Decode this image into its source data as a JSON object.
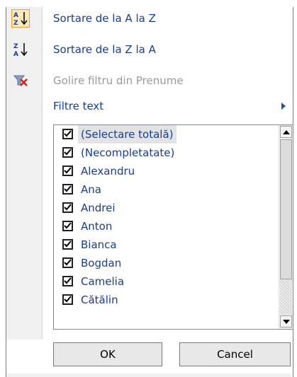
{
  "menu": {
    "items": [
      {
        "label": "Sortare de la A la Z",
        "icon": "sort-asc-icon",
        "state": "normal"
      },
      {
        "label": "Sortare de la Z la A",
        "icon": "sort-desc-icon",
        "state": "normal"
      },
      {
        "label": "Golire filtru din Prenume",
        "icon": "clear-filter-icon",
        "state": "disabled"
      },
      {
        "label": "Filtre text",
        "icon": "",
        "state": "submenu"
      }
    ]
  },
  "list": {
    "items": [
      {
        "label": "(Selectare totală)",
        "checked": true,
        "selected": true
      },
      {
        "label": "(Necompletatate)",
        "checked": true
      },
      {
        "label": "Alexandru",
        "checked": true
      },
      {
        "label": "Ana",
        "checked": true
      },
      {
        "label": "Andrei",
        "checked": true
      },
      {
        "label": "Anton",
        "checked": true
      },
      {
        "label": "Bianca",
        "checked": true
      },
      {
        "label": "Bogdan",
        "checked": true
      },
      {
        "label": "Camelia",
        "checked": true
      },
      {
        "label": "Cătălin",
        "checked": true
      }
    ]
  },
  "buttons": {
    "ok": "OK",
    "cancel": "Cancel"
  },
  "colors": {
    "link": "#1a3d8f",
    "disabled": "#9a9a9a",
    "highlight": "#fde9b8"
  }
}
